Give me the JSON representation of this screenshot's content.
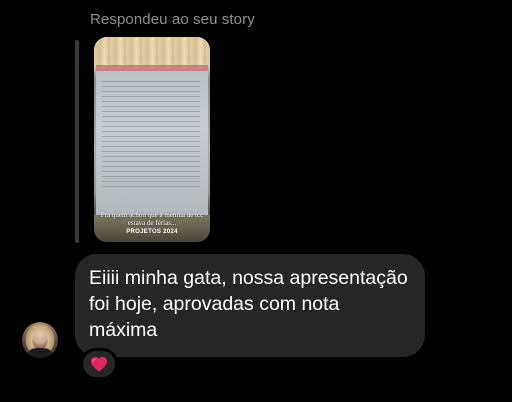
{
  "reply_context": {
    "label": "Respondeu ao seu story",
    "story": {
      "caption": "Pra quem achou que a menina de tcc estava de férias...",
      "tag": "PROJETOS 2024"
    }
  },
  "message": {
    "text": "Eiiii minha gata, nossa apresentação foi hoje, aprovadas com nota máxima",
    "bubble_color": "#262626",
    "text_color": "#ffffff"
  },
  "reaction": {
    "icon": "red-heart-icon",
    "emoji": "❤️",
    "color": "#e0245e"
  },
  "sender": {
    "avatar": "avatar-icon"
  }
}
